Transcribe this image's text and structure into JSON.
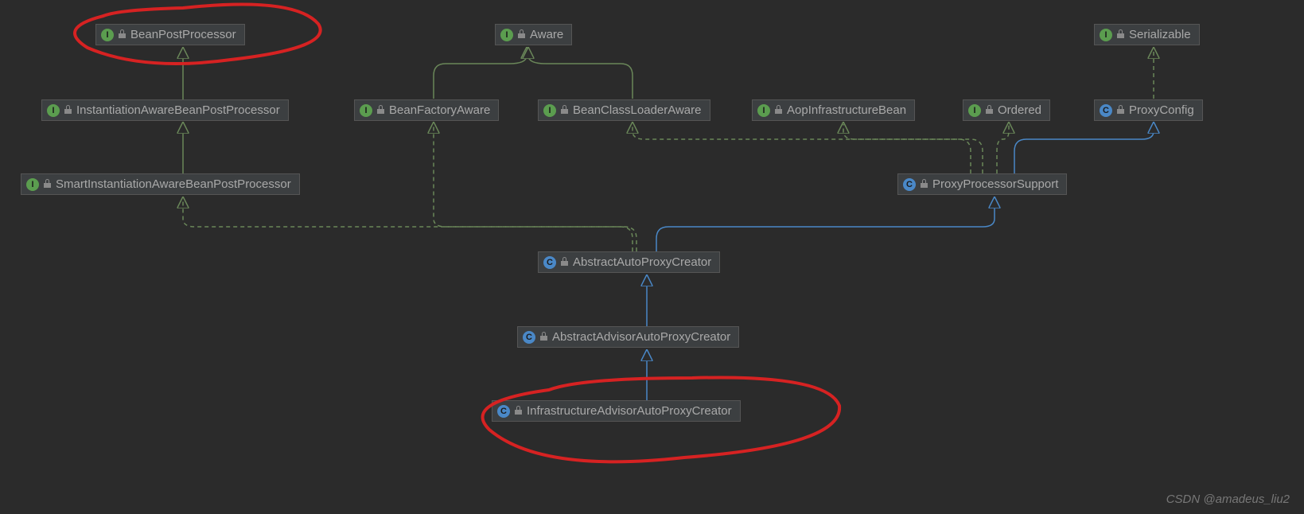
{
  "nodes": {
    "bpp": {
      "label": "BeanPostProcessor",
      "type": "I"
    },
    "aware": {
      "label": "Aware",
      "type": "I"
    },
    "serial": {
      "label": "Serializable",
      "type": "I"
    },
    "iabpp": {
      "label": "InstantiationAwareBeanPostProcessor",
      "type": "I"
    },
    "bfa": {
      "label": "BeanFactoryAware",
      "type": "I"
    },
    "bcla": {
      "label": "BeanClassLoaderAware",
      "type": "I"
    },
    "aib": {
      "label": "AopInfrastructureBean",
      "type": "I"
    },
    "ord": {
      "label": "Ordered",
      "type": "I"
    },
    "pcfg": {
      "label": "ProxyConfig",
      "type": "C"
    },
    "siabpp": {
      "label": "SmartInstantiationAwareBeanPostProcessor",
      "type": "I"
    },
    "pps": {
      "label": "ProxyProcessorSupport",
      "type": "C"
    },
    "aapc": {
      "label": "AbstractAutoProxyCreator",
      "type": "C"
    },
    "aadvpc": {
      "label": "AbstractAdvisorAutoProxyCreator",
      "type": "C"
    },
    "iadvpc": {
      "label": "InfrastructureAdvisorAutoProxyCreator",
      "type": "C"
    }
  },
  "footer": "CSDN @amadeus_liu2",
  "colors": {
    "iface": "#6a8759",
    "class": "#4a88c7",
    "annot": "#cc2222"
  }
}
